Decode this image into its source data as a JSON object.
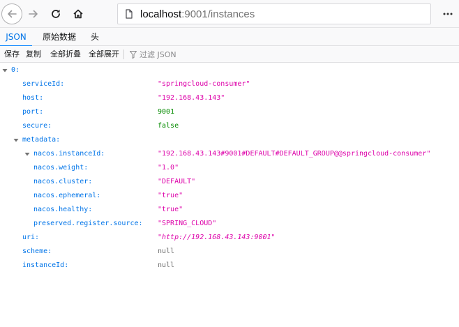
{
  "browser": {
    "url_host": "localhost",
    "url_rest": ":9001/instances"
  },
  "viewer_tabs": [
    "JSON",
    "原始数据",
    "头"
  ],
  "actions": {
    "save": "保存",
    "copy": "复制",
    "collapse_all": "全部折叠",
    "expand_all": "全部展开",
    "filter_placeholder": "过滤 JSON"
  },
  "json_tree": {
    "root_key": "0:",
    "serviceId": {
      "key": "serviceId:",
      "value": "\"springcloud-consumer\""
    },
    "host": {
      "key": "host:",
      "value": "\"192.168.43.143\""
    },
    "port": {
      "key": "port:",
      "value": "9001"
    },
    "secure": {
      "key": "secure:",
      "value": "false"
    },
    "metadata_key": "metadata:",
    "instanceId_meta": {
      "key": "nacos.instanceId:",
      "value": "\"192.168.43.143#9001#DEFAULT#DEFAULT_GROUP@@springcloud-consumer\""
    },
    "weight": {
      "key": "nacos.weight:",
      "value": "\"1.0\""
    },
    "cluster": {
      "key": "nacos.cluster:",
      "value": "\"DEFAULT\""
    },
    "ephemeral": {
      "key": "nacos.ephemeral:",
      "value": "\"true\""
    },
    "healthy": {
      "key": "nacos.healthy:",
      "value": "\"true\""
    },
    "register_source": {
      "key": "preserved.register.source:",
      "value": "\"SPRING_CLOUD\""
    },
    "uri": {
      "key": "uri:",
      "value": "\"http://192.168.43.143:9001\""
    },
    "scheme": {
      "key": "scheme:",
      "value": "null"
    },
    "instanceId": {
      "key": "instanceId:",
      "value": "null"
    }
  },
  "colors": {
    "key": "#0074e8",
    "string": "#dd00a9",
    "number": "#058b00",
    "null": "#737373",
    "tab_active": "#0a84ff"
  }
}
